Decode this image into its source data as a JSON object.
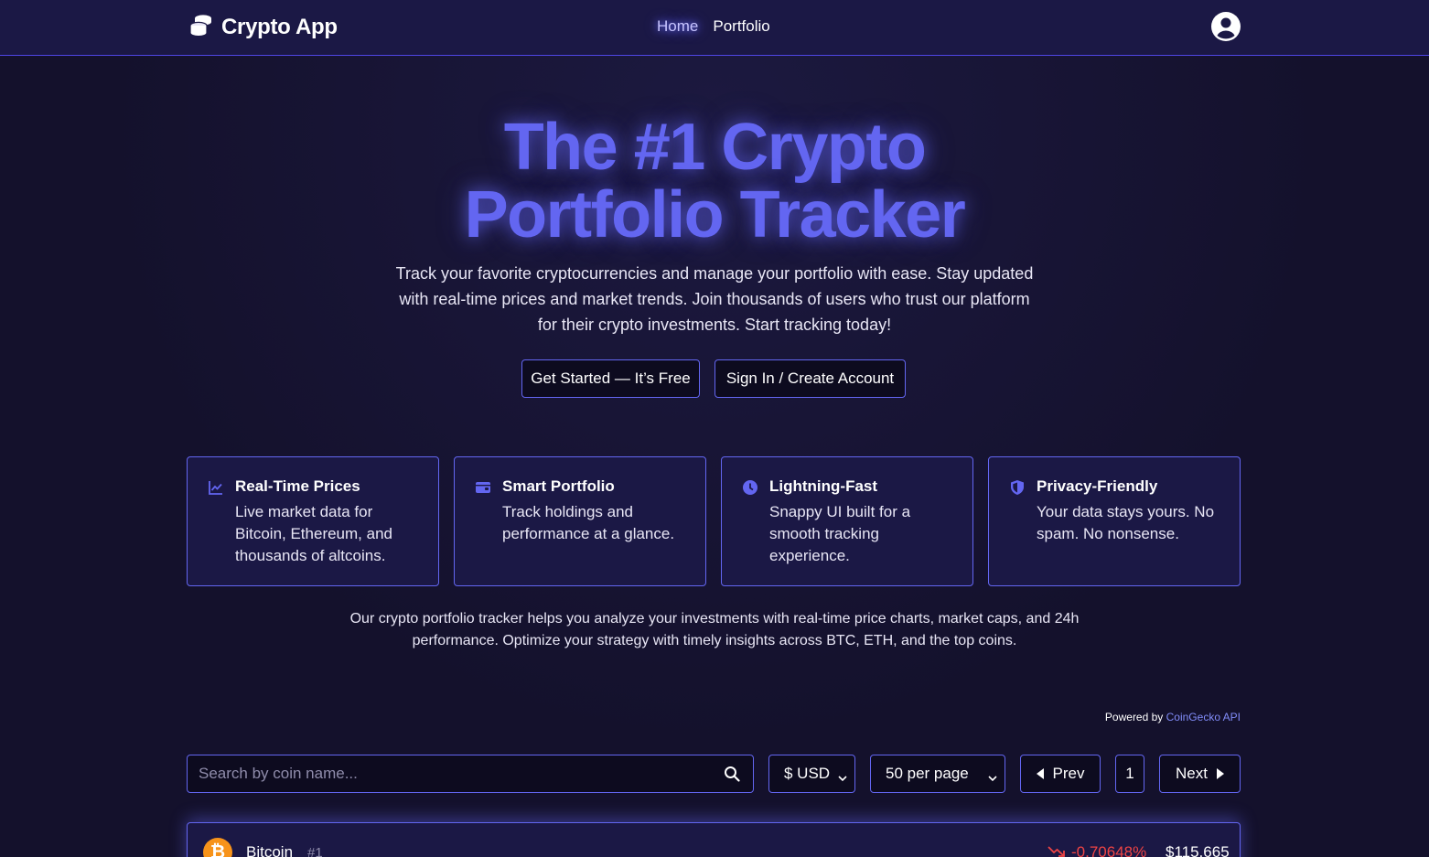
{
  "nav": {
    "brand": "Crypto App",
    "links": [
      {
        "label": "Home",
        "active": true
      },
      {
        "label": "Portfolio",
        "active": false
      }
    ],
    "avatar_icon": "user-circle-icon"
  },
  "hero": {
    "title_line1": "The #1 Crypto",
    "title_line2": "Portfolio Tracker",
    "subtitle": "Track your favorite cryptocurrencies and manage your portfolio with ease. Stay updated with real-time prices and market trends. Join thousands of users who trust our platform for their crypto investments. Start tracking today!",
    "primary_cta": "Get Started — It’s Free",
    "secondary_cta": "Sign In / Create Account"
  },
  "features": [
    {
      "icon": "chart-line-icon",
      "title": "Real-Time Prices",
      "desc": "Live market data for Bitcoin, Ethereum, and thousands of altcoins."
    },
    {
      "icon": "wallet-icon",
      "title": "Smart Portfolio",
      "desc": "Track holdings and performance at a glance."
    },
    {
      "icon": "clock-icon",
      "title": "Lightning-Fast",
      "desc": "Snappy UI built for a smooth tracking experience."
    },
    {
      "icon": "shield-icon",
      "title": "Privacy-Friendly",
      "desc": "Your data stays yours. No spam. No nonsense."
    }
  ],
  "about": "Our crypto portfolio tracker helps you analyze your investments with real-time price charts, market caps, and 24h performance. Optimize your strategy with timely insights across BTC, ETH, and the top coins.",
  "powered": {
    "prefix": "Powered by ",
    "link": "CoinGecko API"
  },
  "controls": {
    "search_placeholder": "Search by coin name...",
    "currency": "$ USD",
    "per_page": "50 per page",
    "prev": "Prev",
    "page": "1",
    "next": "Next"
  },
  "coins": [
    {
      "name": "Bitcoin",
      "rank": "#1",
      "symbol_glyph": "₿",
      "change": "-0.70648%",
      "price": "$115,665"
    }
  ],
  "colors": {
    "accent": "#6366f1",
    "background": "#14112c",
    "navbar": "#1b1845",
    "negative": "#ef4444",
    "bitcoin": "#f7931a"
  }
}
